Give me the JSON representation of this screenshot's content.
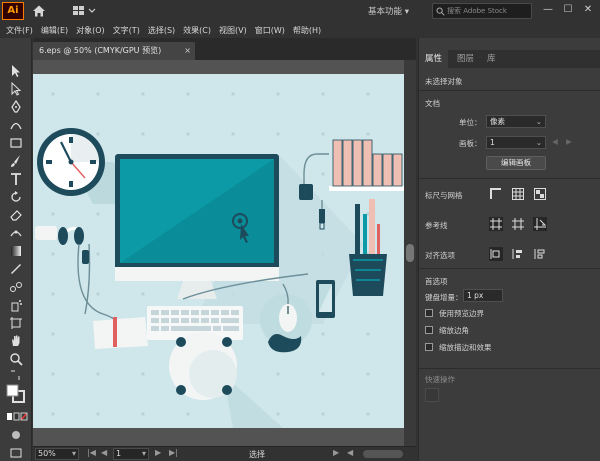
{
  "app": {
    "logo": "Ai",
    "workspace": "基本功能",
    "search_placeholder": "搜索 Adobe Stock",
    "win_minimize": "—",
    "win_restore": "☐",
    "win_close": "✕"
  },
  "menu": [
    "文件(F)",
    "编辑(E)",
    "对象(O)",
    "文字(T)",
    "选择(S)",
    "效果(C)",
    "视图(V)",
    "窗口(W)",
    "帮助(H)"
  ],
  "document": {
    "tab_title": "6.eps @ 50% (CMYK/GPU 预览)",
    "close": "×"
  },
  "statusbar": {
    "zoom": "50%",
    "page": "1",
    "status": "选择"
  },
  "properties": {
    "tabs": [
      "属性",
      "图层",
      "库"
    ],
    "no_selection": "未选择对象",
    "section_document": "文档",
    "unit_label": "单位：",
    "unit_value": "像素",
    "artboard_label": "画板：",
    "artboard_value": "1",
    "edit_artboards": "编辑画板",
    "rulers_grids": "标尺与网格",
    "guides": "参考线",
    "align": "对齐选项",
    "preferences": "首选项",
    "key_increment_label": "键盘增量：",
    "key_increment_value": "1 px",
    "cb_preview_bounds": "使用预览边界",
    "cb_scale_corners": "缩放边角",
    "cb_scale_strokes": "缩放描边和效果",
    "quick_actions": "快速操作"
  },
  "colors": {
    "artboard": "#cfe6ea",
    "monitor_screen": "#0b9aa6",
    "accent_dark": "#1d4b5b",
    "books": "#f0bfb3"
  }
}
